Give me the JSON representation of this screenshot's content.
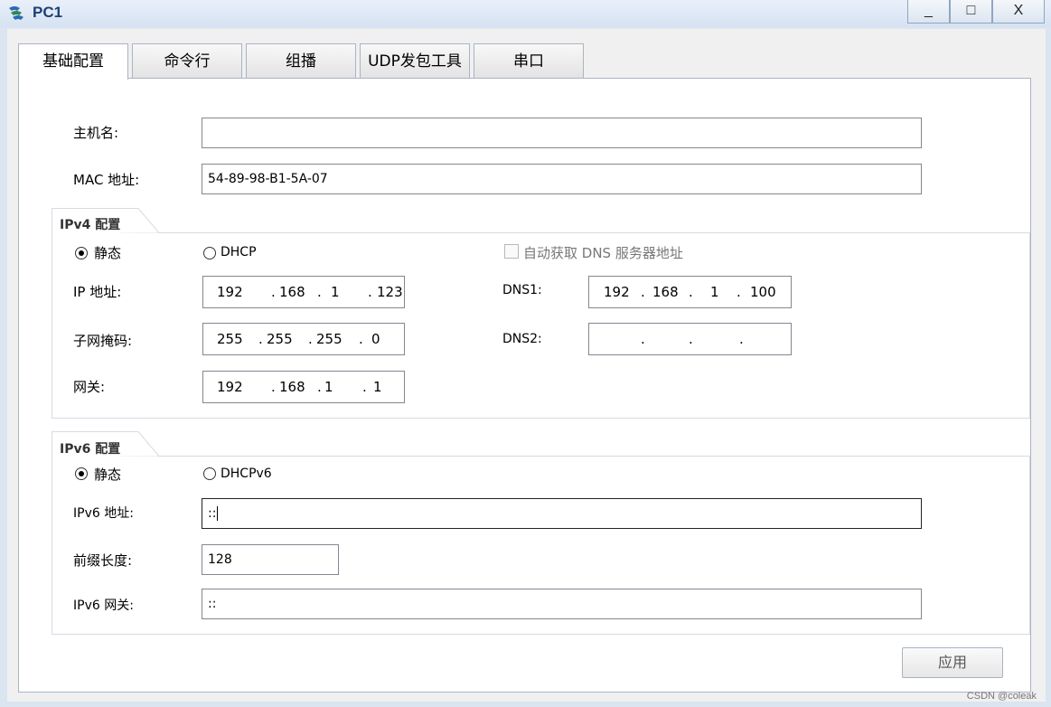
{
  "window": {
    "title": "PC1",
    "minimize": "_",
    "maximize": "□",
    "close": "X"
  },
  "tabs": [
    {
      "label": "基础配置"
    },
    {
      "label": "命令行"
    },
    {
      "label": "组播"
    },
    {
      "label": "UDP发包工具"
    },
    {
      "label": "串口"
    }
  ],
  "basic": {
    "hostname_label": "主机名:",
    "hostname_value": "",
    "mac_label": "MAC 地址:",
    "mac_value": "54-89-98-B1-5A-07"
  },
  "ipv4": {
    "group_title": "IPv4 配置",
    "static_label": "静态",
    "dhcp_label": "DHCP",
    "auto_dns_label": "自动获取 DNS 服务器地址",
    "ip_label": "IP 地址:",
    "ip": [
      "192",
      "168",
      "1",
      "123"
    ],
    "mask_label": "子网掩码:",
    "mask": [
      "255",
      "255",
      "255",
      "0"
    ],
    "gw_label": "网关:",
    "gw": [
      "192",
      "168",
      "1",
      "1"
    ],
    "dns1_label": "DNS1:",
    "dns1": [
      "192",
      "168",
      "1",
      "100"
    ],
    "dns2_label": "DNS2:",
    "dns2": [
      "",
      "",
      "",
      ""
    ]
  },
  "ipv6": {
    "group_title": "IPv6 配置",
    "static_label": "静态",
    "dhcp_label": "DHCPv6",
    "addr_label": "IPv6 地址:",
    "addr_value": "::",
    "prefix_label": "前缀长度:",
    "prefix_value": "128",
    "gw_label": "IPv6 网关:",
    "gw_value": "::"
  },
  "apply_label": "应用",
  "watermark": "CSDN @coleak"
}
